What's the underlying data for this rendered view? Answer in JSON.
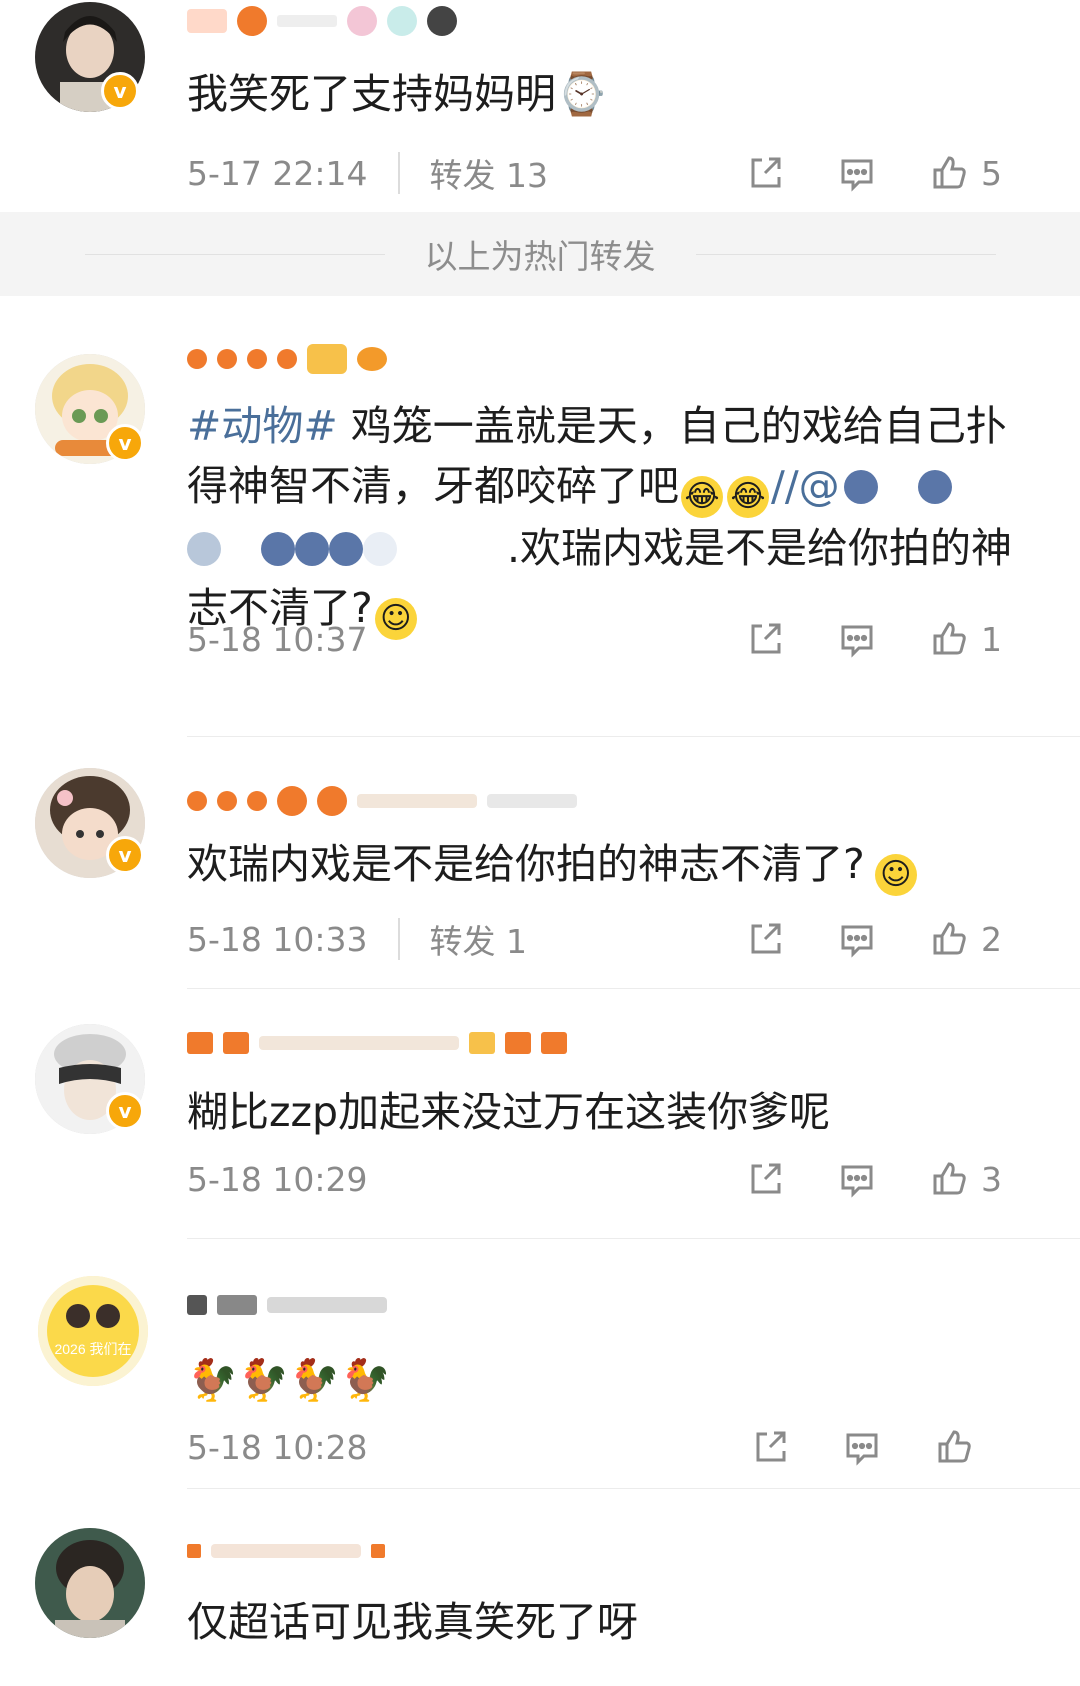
{
  "comments": [
    {
      "text": "我笑死了支持妈妈明⌚",
      "time": "5-17 22:14",
      "repost_label": "转发 13",
      "likes": "5"
    },
    {
      "hashtag": "#动物#",
      "text": " 鸡笼一盖就是天，自己的戏给自己扑得神智不清，牙都咬碎了吧",
      "repost_prefix": "//@",
      "quoted": ".欢瑞内戏是不是给你拍的神志不清了?",
      "time": "5-18 10:37",
      "likes": "1"
    },
    {
      "text": "欢瑞内戏是不是给你拍的神志不清了?",
      "time": "5-18 10:33",
      "repost_label": "转发 1",
      "likes": "2"
    },
    {
      "text": "糊比zzp加起来没过万在这装你爹呢",
      "time": "5-18 10:29",
      "likes": "3"
    },
    {
      "text": "🐓🐓🐓🐓",
      "time": "5-18 10:28",
      "likes": ""
    },
    {
      "text": "仅超话可见我真笑死了呀"
    }
  ],
  "hot_repost_label": "以上为热门转发",
  "avatar5_caption": "2026 我们在",
  "icons": {
    "share": "share-icon",
    "comment": "comment-icon",
    "like": "thumbs-up-icon",
    "verified": "verified-badge-icon"
  },
  "colors": {
    "hashtag": "#4a6f9a",
    "meta": "#8a8a8a",
    "verified": "#f7a70a"
  }
}
